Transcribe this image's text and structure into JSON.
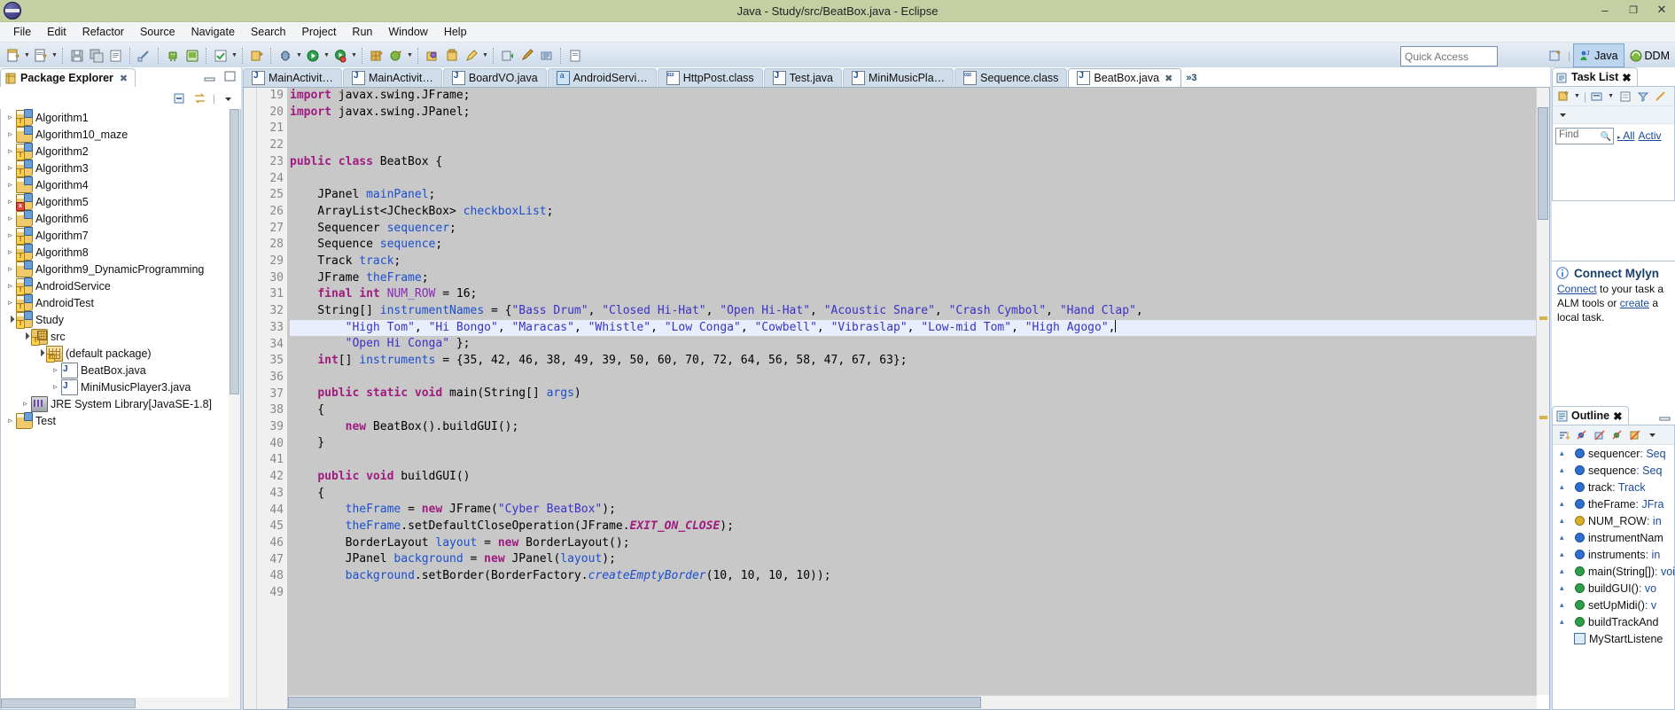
{
  "window": {
    "title": "Java - Study/src/BeatBox.java - Eclipse",
    "minimize": "–",
    "maximize": "❐",
    "close": "✕",
    "logo_icon": "eclipse-logo-icon"
  },
  "menubar": {
    "items": [
      "File",
      "Edit",
      "Refactor",
      "Source",
      "Navigate",
      "Search",
      "Project",
      "Run",
      "Window",
      "Help"
    ]
  },
  "toolbar": {
    "quick_access_placeholder": "Quick Access",
    "perspectives": [
      {
        "label": "Java",
        "active": true,
        "icon": "java-perspective-icon"
      },
      {
        "label": "DDM",
        "active": false,
        "icon": "ddms-perspective-icon"
      }
    ],
    "open_perspective_icon": "open-perspective-icon"
  },
  "package_explorer": {
    "tab_label": "Package Explorer",
    "close_icon": "✖",
    "collapse_all_icon": "collapse-all-icon",
    "link_with_editor_icon": "link-with-editor-icon",
    "view_menu_icon": "view-menu-icon",
    "minimize_icon": "minimize-icon",
    "maximize_icon": "maximize-icon",
    "tree": [
      {
        "label": "Algorithm1",
        "indent": 0,
        "state": "closed",
        "icon": "java-project-warning-icon"
      },
      {
        "label": "Algorithm10_maze",
        "indent": 0,
        "state": "closed",
        "icon": "java-project-icon"
      },
      {
        "label": "Algorithm2",
        "indent": 0,
        "state": "closed",
        "icon": "java-project-warning-icon"
      },
      {
        "label": "Algorithm3",
        "indent": 0,
        "state": "closed",
        "icon": "java-project-warning-icon"
      },
      {
        "label": "Algorithm4",
        "indent": 0,
        "state": "closed",
        "icon": "java-project-icon"
      },
      {
        "label": "Algorithm5",
        "indent": 0,
        "state": "closed",
        "icon": "java-project-error-icon"
      },
      {
        "label": "Algorithm6",
        "indent": 0,
        "state": "closed",
        "icon": "java-project-icon"
      },
      {
        "label": "Algorithm7",
        "indent": 0,
        "state": "closed",
        "icon": "java-project-warning-icon"
      },
      {
        "label": "Algorithm8",
        "indent": 0,
        "state": "closed",
        "icon": "java-project-warning-icon"
      },
      {
        "label": "Algorithm9_DynamicProgramming",
        "indent": 0,
        "state": "closed",
        "icon": "java-project-icon"
      },
      {
        "label": "AndroidService",
        "indent": 0,
        "state": "closed",
        "icon": "android-project-warning-icon"
      },
      {
        "label": "AndroidTest",
        "indent": 0,
        "state": "closed",
        "icon": "android-project-warning-icon"
      },
      {
        "label": "Study",
        "indent": 0,
        "state": "open",
        "icon": "java-project-warning-icon"
      },
      {
        "label": "src",
        "indent": 1,
        "state": "open",
        "icon": "source-folder-icon"
      },
      {
        "label": "(default package)",
        "indent": 2,
        "state": "open",
        "icon": "package-warning-icon"
      },
      {
        "label": "BeatBox.java",
        "indent": 3,
        "state": "closed",
        "icon": "java-file-icon"
      },
      {
        "label": "MiniMusicPlayer3.java",
        "indent": 3,
        "state": "closed",
        "icon": "java-file-icon"
      },
      {
        "label": "JRE System Library",
        "suffix": " [JavaSE-1.8]",
        "indent": 1,
        "state": "closed",
        "icon": "jre-library-icon"
      },
      {
        "label": "Test",
        "indent": 0,
        "state": "closed",
        "icon": "java-project-icon"
      }
    ]
  },
  "editor": {
    "tabs": [
      {
        "label": "MainActivit…",
        "icon": "java-file-icon",
        "active": false
      },
      {
        "label": "MainActivit…",
        "icon": "java-file-icon",
        "active": false
      },
      {
        "label": "BoardVO.java",
        "icon": "java-file-icon",
        "active": false
      },
      {
        "label": "AndroidServi…",
        "icon": "xml-file-icon",
        "active": false
      },
      {
        "label": "HttpPost.class",
        "icon": "class-file-icon",
        "active": false
      },
      {
        "label": "Test.java",
        "icon": "java-file-icon",
        "active": false
      },
      {
        "label": "MiniMusicPla…",
        "icon": "java-file-icon",
        "active": false
      },
      {
        "label": "Sequence.class",
        "icon": "class-file-icon",
        "active": false
      },
      {
        "label": "BeatBox.java",
        "icon": "java-file-icon",
        "active": true,
        "close_icon": "✖"
      }
    ],
    "more_tabs_label": "»3",
    "first_line_number": 19,
    "highlight_line": 33,
    "lines": [
      {
        "n": 19,
        "segments": [
          {
            "t": "import",
            "c": "kw"
          },
          {
            "t": " javax.swing.JFrame;",
            "c": ""
          }
        ]
      },
      {
        "n": 20,
        "segments": [
          {
            "t": "import",
            "c": "kw"
          },
          {
            "t": " javax.swing.JPanel;",
            "c": ""
          }
        ]
      },
      {
        "n": 21,
        "segments": []
      },
      {
        "n": 22,
        "segments": []
      },
      {
        "n": 23,
        "segments": [
          {
            "t": "public class",
            "c": "kw"
          },
          {
            "t": " BeatBox {",
            "c": ""
          }
        ]
      },
      {
        "n": 24,
        "segments": []
      },
      {
        "n": 25,
        "segments": [
          {
            "t": "    JPanel ",
            "c": ""
          },
          {
            "t": "mainPanel",
            "c": "fld"
          },
          {
            "t": ";",
            "c": ""
          }
        ]
      },
      {
        "n": 26,
        "segments": [
          {
            "t": "    ArrayList<JCheckBox> ",
            "c": ""
          },
          {
            "t": "checkboxList",
            "c": "fld"
          },
          {
            "t": ";",
            "c": ""
          }
        ]
      },
      {
        "n": 27,
        "segments": [
          {
            "t": "    Sequencer ",
            "c": ""
          },
          {
            "t": "sequencer",
            "c": "fld"
          },
          {
            "t": ";",
            "c": ""
          }
        ]
      },
      {
        "n": 28,
        "segments": [
          {
            "t": "    Sequence ",
            "c": ""
          },
          {
            "t": "sequence",
            "c": "fld"
          },
          {
            "t": ";",
            "c": ""
          }
        ]
      },
      {
        "n": 29,
        "segments": [
          {
            "t": "    Track ",
            "c": ""
          },
          {
            "t": "track",
            "c": "fld"
          },
          {
            "t": ";",
            "c": ""
          }
        ]
      },
      {
        "n": 30,
        "segments": [
          {
            "t": "    JFrame ",
            "c": ""
          },
          {
            "t": "theFrame",
            "c": "fld"
          },
          {
            "t": ";",
            "c": ""
          }
        ]
      },
      {
        "n": 31,
        "segments": [
          {
            "t": "    ",
            "c": ""
          },
          {
            "t": "final int",
            "c": "kw"
          },
          {
            "t": " ",
            "c": ""
          },
          {
            "t": "NUM_ROW",
            "c": "cst"
          },
          {
            "t": " = 16;",
            "c": ""
          }
        ]
      },
      {
        "n": 32,
        "segments": [
          {
            "t": "    String[] ",
            "c": ""
          },
          {
            "t": "instrumentNames",
            "c": "fld"
          },
          {
            "t": " = {",
            "c": ""
          },
          {
            "t": "\"Bass Drum\"",
            "c": "str"
          },
          {
            "t": ", ",
            "c": ""
          },
          {
            "t": "\"Closed Hi-Hat\"",
            "c": "str"
          },
          {
            "t": ", ",
            "c": ""
          },
          {
            "t": "\"Open Hi-Hat\"",
            "c": "str"
          },
          {
            "t": ", ",
            "c": ""
          },
          {
            "t": "\"Acoustic Snare\"",
            "c": "str"
          },
          {
            "t": ", ",
            "c": ""
          },
          {
            "t": "\"Crash Cymbol\"",
            "c": "str"
          },
          {
            "t": ", ",
            "c": ""
          },
          {
            "t": "\"Hand Clap\"",
            "c": "str"
          },
          {
            "t": ",",
            "c": ""
          }
        ]
      },
      {
        "n": 33,
        "segments": [
          {
            "t": "        ",
            "c": ""
          },
          {
            "t": "\"High Tom\"",
            "c": "str"
          },
          {
            "t": ", ",
            "c": ""
          },
          {
            "t": "\"Hi Bongo\"",
            "c": "str"
          },
          {
            "t": ", ",
            "c": ""
          },
          {
            "t": "\"Maracas\"",
            "c": "str"
          },
          {
            "t": ", ",
            "c": ""
          },
          {
            "t": "\"Whistle\"",
            "c": "str"
          },
          {
            "t": ", ",
            "c": ""
          },
          {
            "t": "\"Low Conga\"",
            "c": "str"
          },
          {
            "t": ", ",
            "c": ""
          },
          {
            "t": "\"Cowbell\"",
            "c": "str"
          },
          {
            "t": ", ",
            "c": ""
          },
          {
            "t": "\"Vibraslap\"",
            "c": "str"
          },
          {
            "t": ", ",
            "c": ""
          },
          {
            "t": "\"Low-mid Tom\"",
            "c": "str"
          },
          {
            "t": ", ",
            "c": ""
          },
          {
            "t": "\"High Agogo\"",
            "c": "str"
          },
          {
            "t": ",",
            "c": ""
          }
        ]
      },
      {
        "n": 34,
        "segments": [
          {
            "t": "        ",
            "c": ""
          },
          {
            "t": "\"Open Hi Conga\"",
            "c": "str"
          },
          {
            "t": " };",
            "c": ""
          }
        ]
      },
      {
        "n": 35,
        "segments": [
          {
            "t": "    ",
            "c": ""
          },
          {
            "t": "int",
            "c": "kw"
          },
          {
            "t": "[] ",
            "c": ""
          },
          {
            "t": "instruments",
            "c": "fld"
          },
          {
            "t": " = {35, 42, 46, 38, 49, 39, 50, 60, 70, 72, 64, 56, 58, 47, 67, 63};",
            "c": ""
          }
        ]
      },
      {
        "n": 36,
        "segments": []
      },
      {
        "n": 37,
        "segments": [
          {
            "t": "    ",
            "c": ""
          },
          {
            "t": "public static void",
            "c": "kw"
          },
          {
            "t": " main(String[] ",
            "c": ""
          },
          {
            "t": "args",
            "c": "fld"
          },
          {
            "t": ")",
            "c": ""
          }
        ],
        "fold": true
      },
      {
        "n": 38,
        "segments": [
          {
            "t": "    {",
            "c": ""
          }
        ]
      },
      {
        "n": 39,
        "segments": [
          {
            "t": "        ",
            "c": ""
          },
          {
            "t": "new",
            "c": "kw"
          },
          {
            "t": " BeatBox().buildGUI();",
            "c": ""
          }
        ]
      },
      {
        "n": 40,
        "segments": [
          {
            "t": "    }",
            "c": ""
          }
        ]
      },
      {
        "n": 41,
        "segments": []
      },
      {
        "n": 42,
        "segments": [
          {
            "t": "    ",
            "c": ""
          },
          {
            "t": "public void",
            "c": "kw"
          },
          {
            "t": " buildGUI()",
            "c": ""
          }
        ],
        "fold": true
      },
      {
        "n": 43,
        "segments": [
          {
            "t": "    {",
            "c": ""
          }
        ]
      },
      {
        "n": 44,
        "segments": [
          {
            "t": "        ",
            "c": ""
          },
          {
            "t": "theFrame",
            "c": "fld"
          },
          {
            "t": " = ",
            "c": ""
          },
          {
            "t": "new",
            "c": "kw"
          },
          {
            "t": " JFrame(",
            "c": ""
          },
          {
            "t": "\"Cyber BeatBox\"",
            "c": "str"
          },
          {
            "t": ");",
            "c": ""
          }
        ]
      },
      {
        "n": 45,
        "segments": [
          {
            "t": "        ",
            "c": ""
          },
          {
            "t": "theFrame",
            "c": "fld"
          },
          {
            "t": ".setDefaultCloseOperation(JFrame.",
            "c": ""
          },
          {
            "t": "EXIT_ON_CLOSE",
            "c": "statk"
          },
          {
            "t": ");",
            "c": ""
          }
        ]
      },
      {
        "n": 46,
        "segments": [
          {
            "t": "        BorderLayout ",
            "c": ""
          },
          {
            "t": "layout",
            "c": "fld"
          },
          {
            "t": " = ",
            "c": ""
          },
          {
            "t": "new",
            "c": "kw"
          },
          {
            "t": " BorderLayout();",
            "c": ""
          }
        ]
      },
      {
        "n": 47,
        "segments": [
          {
            "t": "        JPanel ",
            "c": ""
          },
          {
            "t": "background",
            "c": "fld"
          },
          {
            "t": " = ",
            "c": ""
          },
          {
            "t": "new",
            "c": "kw"
          },
          {
            "t": " JPanel(",
            "c": ""
          },
          {
            "t": "layout",
            "c": "fld"
          },
          {
            "t": ");",
            "c": ""
          }
        ]
      },
      {
        "n": 48,
        "segments": [
          {
            "t": "        ",
            "c": ""
          },
          {
            "t": "background",
            "c": "fld"
          },
          {
            "t": ".setBorder(BorderFactory.",
            "c": ""
          },
          {
            "t": "createEmptyBorder",
            "c": "stat"
          },
          {
            "t": "(10, 10, 10, 10));",
            "c": ""
          }
        ]
      },
      {
        "n": 49,
        "segments": []
      }
    ]
  },
  "task_list": {
    "tab_label": "Task List",
    "close_icon": "✖",
    "new_task_icon": "new-task-icon",
    "categorize_icon": "categorize-icon",
    "focus_icon": "focus-icon",
    "schedule_icon": "schedule-icon",
    "filter_icon": "filter-icon",
    "view_menu_icon": "view-menu-icon",
    "minimize_icon": "minimize-icon",
    "find_placeholder": "Find",
    "search_icon": "search-icon",
    "filters": [
      "All",
      "Activ"
    ]
  },
  "mylyn": {
    "title": "Connect Mylyn",
    "info_icon": "info-icon",
    "minimize_icon": "minimize-icon",
    "text_parts": {
      "link1": "Connect",
      "mid1": " to your task a",
      "mid2": "ALM tools or ",
      "link2": "create",
      "mid3": " a",
      "tail": "local task."
    }
  },
  "outline": {
    "tab_label": "Outline",
    "close_icon": "✖",
    "sort_icon": "sort-icon",
    "hide_fields_icon": "hide-fields-icon",
    "hide_static_icon": "hide-static-icon",
    "hide_nonpublic_icon": "hide-nonpublic-icon",
    "hide_local_icon": "hide-local-types-icon",
    "view_menu_icon": "view-menu-icon",
    "items": [
      {
        "name": "sequencer",
        "type": " : Seq",
        "icon": "private-field-icon",
        "mod": "▴"
      },
      {
        "name": "sequence",
        "type": " : Seq",
        "icon": "private-field-icon",
        "mod": "▴"
      },
      {
        "name": "track",
        "type": " : Track",
        "icon": "private-field-icon",
        "mod": "▴"
      },
      {
        "name": "theFrame",
        "type": " : JFra",
        "icon": "private-field-icon",
        "mod": "▴"
      },
      {
        "name": "NUM_ROW",
        "type": " : in",
        "icon": "private-final-field-icon",
        "mod": "▴"
      },
      {
        "name": "instrumentNam",
        "type": "",
        "icon": "private-field-icon",
        "mod": "▴"
      },
      {
        "name": "instruments",
        "type": " : in",
        "icon": "private-field-icon",
        "mod": "▴"
      },
      {
        "name": "main(String[])",
        "type": " : voi",
        "icon": "public-static-method-icon",
        "mod": "▴"
      },
      {
        "name": "buildGUI()",
        "type": " : vo",
        "icon": "public-method-icon",
        "mod": "▴"
      },
      {
        "name": "setUpMidi()",
        "type": " : v",
        "icon": "public-method-icon",
        "mod": "▴"
      },
      {
        "name": "buildTrackAnd",
        "type": "",
        "icon": "public-method-icon",
        "mod": "▴"
      },
      {
        "name": "MyStartListene",
        "type": "",
        "icon": "inner-class-icon",
        "mod": ""
      }
    ]
  }
}
